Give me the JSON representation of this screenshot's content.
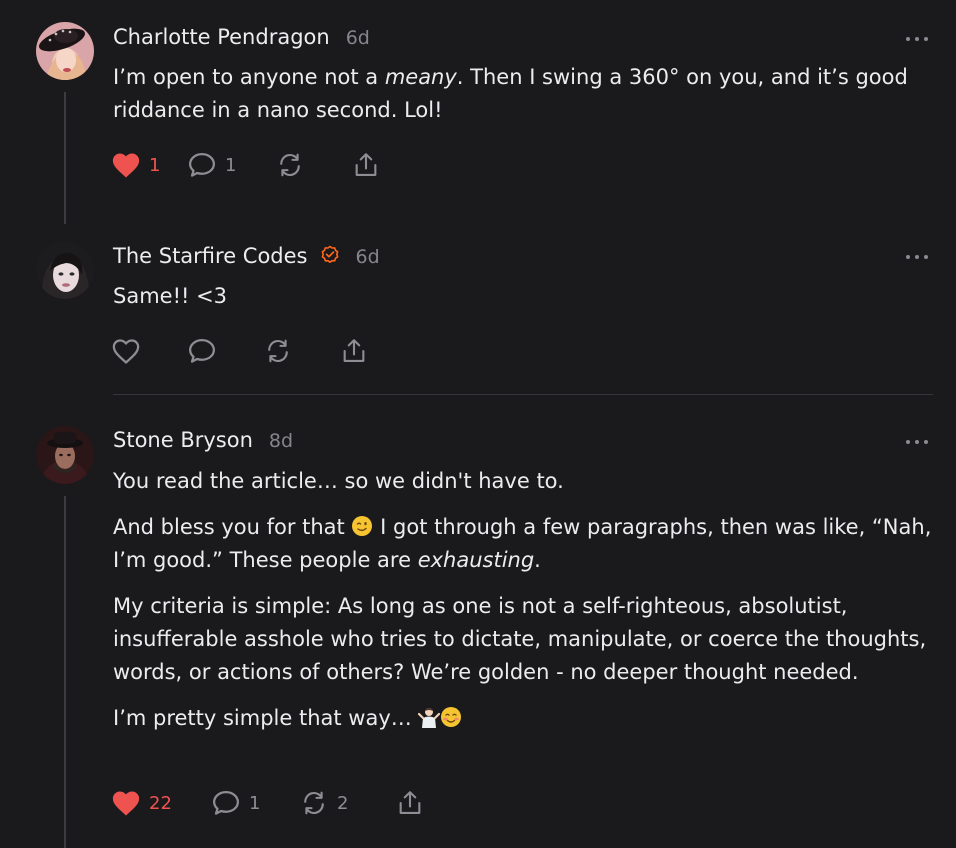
{
  "comments": [
    {
      "author": "Charlotte Pendragon",
      "age": "6d",
      "body": {
        "pre": "I’m open to anyone not a ",
        "em": "meany",
        "post": ". Then I swing a 360° on you, and it’s good riddance in a nano second. Lol!"
      },
      "likes": "1",
      "replies": "1",
      "liked": true,
      "avatar_icon": "woman-with-hat-avatar"
    },
    {
      "author": "The Starfire Codes",
      "age": "6d",
      "verified": true,
      "body": {
        "text": "Same!! <3"
      },
      "liked": false,
      "avatar_icon": "woman-portrait-avatar"
    },
    {
      "author": "Stone Bryson",
      "age": "8d",
      "paragraphs": {
        "p1": "You read the article… so we didn't have to.",
        "p2_a": "And bless you for that",
        "p2_b": " I got through a few paragraphs, then was like, “Nah, I’m good.” These people are ",
        "p2_em": "exhausting",
        "p2_c": ".",
        "p3": "My criteria is simple: As long as one is not a self-righteous, absolutist, insufferable asshole who tries to dictate, manipulate, or coerce the thoughts, words, or actions of others? We’re golden - no deeper thought needed.",
        "p4": "I’m pretty simple that way…"
      },
      "emojis": [
        "winking-face-emoji",
        "person-shrugging-emoji",
        "smiling-face-emoji"
      ],
      "likes": "22",
      "replies": "1",
      "restacks": "2",
      "liked": true,
      "avatar_icon": "man-with-hat-avatar"
    }
  ],
  "colors": {
    "background": "#1a1a1d",
    "like_active": "#ef5350",
    "verified_badge": "#ff6719",
    "icon_muted": "#8d8d93"
  },
  "icons": [
    "heart-icon",
    "comment-icon",
    "restack-icon",
    "share-icon",
    "more-options-icon",
    "verified-badge-icon"
  ]
}
